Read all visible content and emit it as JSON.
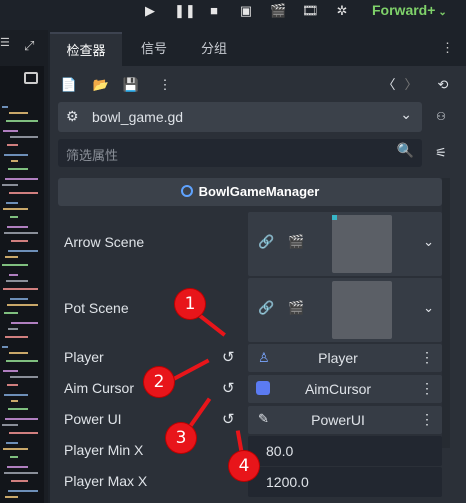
{
  "topbar": {
    "renderer_label": "Forward+",
    "icons": [
      "play-icon",
      "pause-icon",
      "stop-icon",
      "remote-debug-icon",
      "play-scene-icon",
      "play-custom-scene-icon",
      "movie-maker-icon"
    ]
  },
  "tabs": [
    {
      "label": "检查器",
      "active": true
    },
    {
      "label": "信号",
      "active": false
    },
    {
      "label": "分组",
      "active": false
    }
  ],
  "script": {
    "file_name": "bowl_game.gd"
  },
  "filter": {
    "placeholder": "筛选属性"
  },
  "class_header": {
    "name": "BowlGameManager"
  },
  "properties": [
    {
      "label": "Arrow Scene",
      "type": "packed_scene"
    },
    {
      "label": "Pot Scene",
      "type": "packed_scene"
    },
    {
      "label": "Player",
      "type": "node",
      "value": "Player"
    },
    {
      "label": "Aim Cursor",
      "type": "node",
      "value": "AimCursor"
    },
    {
      "label": "Power UI",
      "type": "node",
      "value": "PowerUI"
    },
    {
      "label": "Player Min X",
      "type": "number",
      "value": "80.0"
    },
    {
      "label": "Player Max X",
      "type": "number",
      "value": "1200.0"
    }
  ],
  "annotations": [
    "1",
    "2",
    "3",
    "4"
  ],
  "colors": {
    "accent_green": "#7fd26a",
    "badge_red": "#e8151a",
    "panel": "#2b3038",
    "field": "#363c45"
  }
}
